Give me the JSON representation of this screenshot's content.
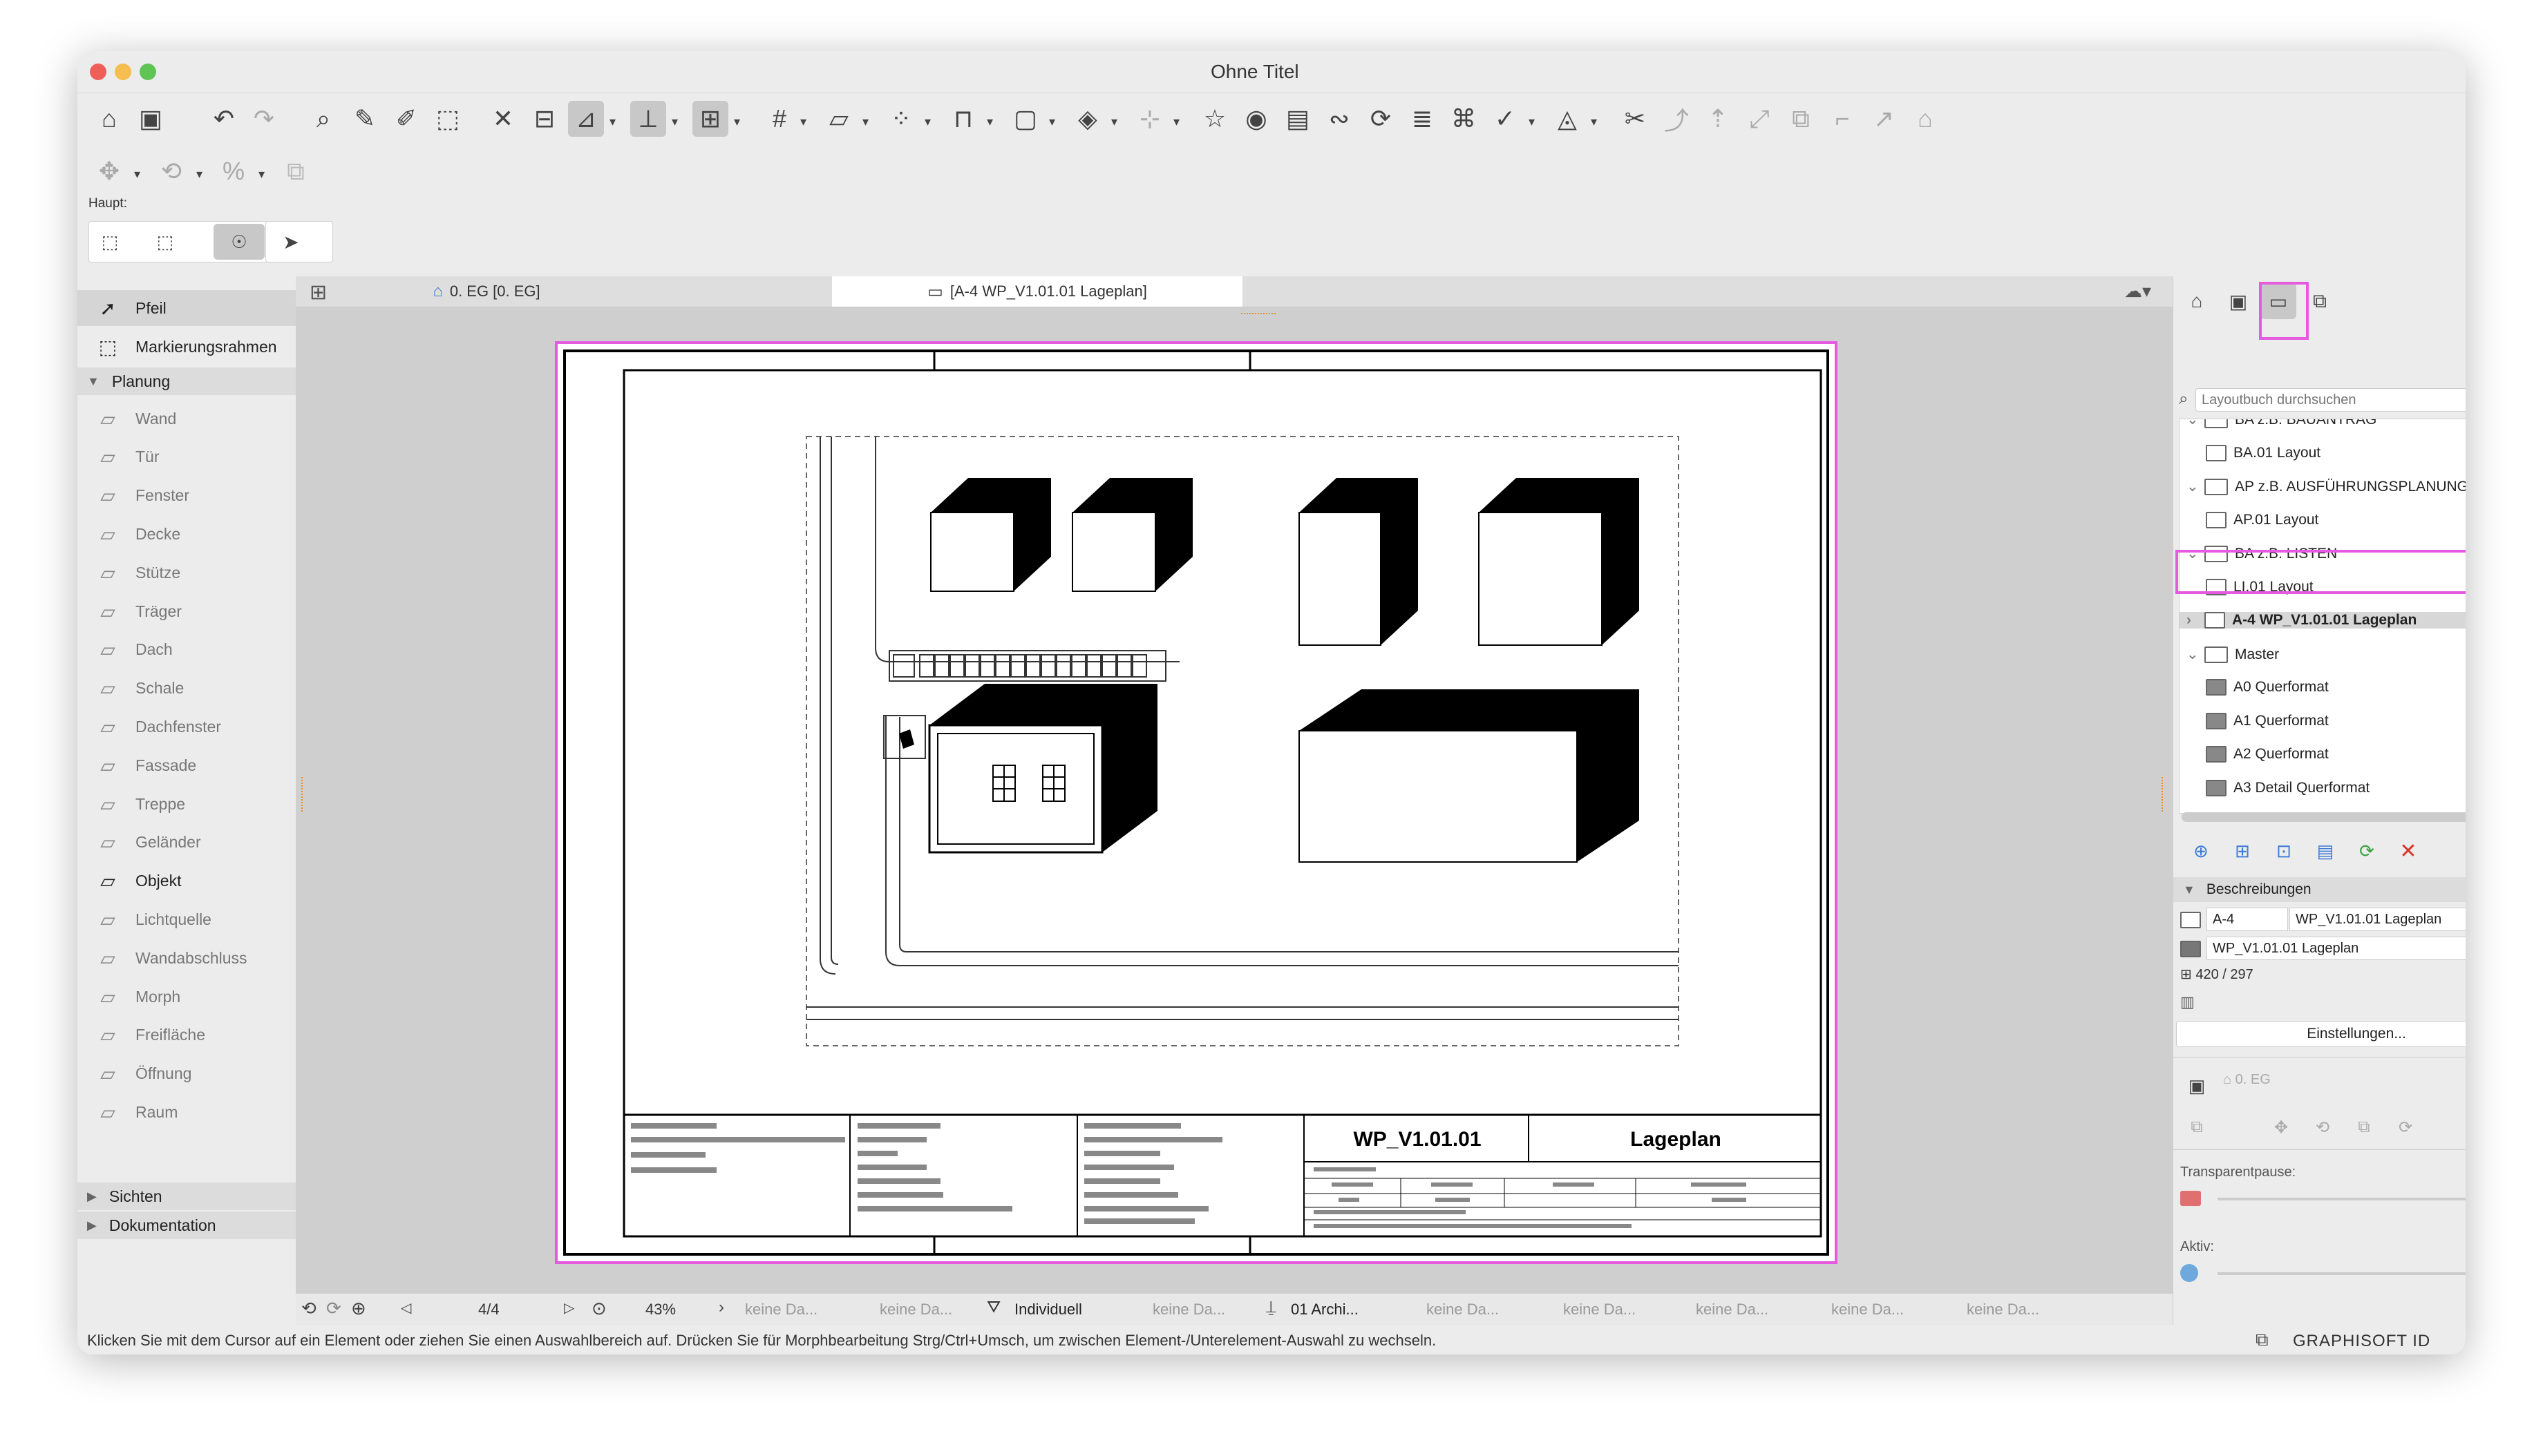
{
  "window": {
    "title": "Ohne Titel"
  },
  "toolbar": {
    "haupt_label": "Haupt:"
  },
  "left_panel": {
    "tools_top": [
      {
        "label": "Pfeil",
        "icon": "arrow-icon"
      },
      {
        "label": "Markierungsrahmen",
        "icon": "marquee-icon"
      }
    ],
    "group_planung": "Planung",
    "planung_tools": [
      {
        "label": "Wand",
        "icon": "wall-icon"
      },
      {
        "label": "Tür",
        "icon": "door-icon"
      },
      {
        "label": "Fenster",
        "icon": "window-icon"
      },
      {
        "label": "Decke",
        "icon": "slab-icon"
      },
      {
        "label": "Stütze",
        "icon": "column-icon"
      },
      {
        "label": "Träger",
        "icon": "beam-icon"
      },
      {
        "label": "Dach",
        "icon": "roof-icon"
      },
      {
        "label": "Schale",
        "icon": "shell-icon"
      },
      {
        "label": "Dachfenster",
        "icon": "skylight-icon"
      },
      {
        "label": "Fassade",
        "icon": "curtain-wall-icon"
      },
      {
        "label": "Treppe",
        "icon": "stair-icon"
      },
      {
        "label": "Geländer",
        "icon": "railing-icon"
      },
      {
        "label": "Objekt",
        "icon": "object-icon"
      },
      {
        "label": "Lichtquelle",
        "icon": "lamp-icon"
      },
      {
        "label": "Wandabschluss",
        "icon": "wall-end-icon"
      },
      {
        "label": "Morph",
        "icon": "morph-icon"
      },
      {
        "label": "Freifläche",
        "icon": "mesh-icon"
      },
      {
        "label": "Öffnung",
        "icon": "opening-icon"
      },
      {
        "label": "Raum",
        "icon": "zone-icon"
      }
    ],
    "group_sichten": "Sichten",
    "group_dokumentation": "Dokumentation"
  },
  "tabs": [
    {
      "label": "0. EG [0. EG]"
    },
    {
      "label": "[A-4 WP_V1.01.01 Lageplan]"
    }
  ],
  "sheet": {
    "title_block": {
      "number": "WP_V1.01.01",
      "name": "Lageplan"
    }
  },
  "statusbar": {
    "page": "4/4",
    "zoom": "43%",
    "placeholder": "keine Da...",
    "scale": "Individuell",
    "layer": "01 Archi..."
  },
  "message": "Klicken Sie mit dem Cursor auf ein Element oder ziehen Sie einen Auswahlbereich auf. Drücken Sie für Morphbearbeitung Strg/Ctrl+Umsch, um zwischen Element-/Unterelement-Auswahl zu wechseln.",
  "brand": "GRAPHISOFT ID",
  "navigator": {
    "search_placeholder": "Layoutbuch durchsuchen",
    "items": [
      {
        "label": "BA z.B. BAUANTRAG",
        "level": 1,
        "type": "folder"
      },
      {
        "label": "BA.01 Layout",
        "level": 2,
        "type": "layout"
      },
      {
        "label": "AP z.B. AUSFÜHRUNGSPLANUNG",
        "level": 1,
        "type": "folder"
      },
      {
        "label": "AP.01 Layout",
        "level": 2,
        "type": "layout"
      },
      {
        "label": "BA z.B. LISTEN",
        "level": 1,
        "type": "folder"
      },
      {
        "label": "LI.01 Layout",
        "level": 2,
        "type": "layout"
      },
      {
        "label": "A-4 WP_V1.01.01 Lageplan",
        "level": 1,
        "type": "layout",
        "selected": true
      },
      {
        "label": "Master",
        "level": 1,
        "type": "folder"
      },
      {
        "label": "A0 Querformat",
        "level": 2,
        "type": "master"
      },
      {
        "label": "A1 Querformat",
        "level": 2,
        "type": "master"
      },
      {
        "label": "A2 Querformat",
        "level": 2,
        "type": "master"
      },
      {
        "label": "A3 Detail Querformat",
        "level": 2,
        "type": "master"
      }
    ],
    "section_beschreibungen": "Beschreibungen",
    "id_value": "A-4",
    "name_value": "WP_V1.01.01 Lageplan",
    "name_dropdown": "WP_V1.01.01 Lageplan",
    "size_value": "420 / 297",
    "settings_button": "Einstellungen...",
    "story_value": "0. EG",
    "transparentpause_label": "Transparentpause:",
    "aktiv_label": "Aktiv:"
  },
  "colors": {
    "highlight": "#e55be0",
    "delete": "#d9342b",
    "refresh": "#3aa043"
  }
}
